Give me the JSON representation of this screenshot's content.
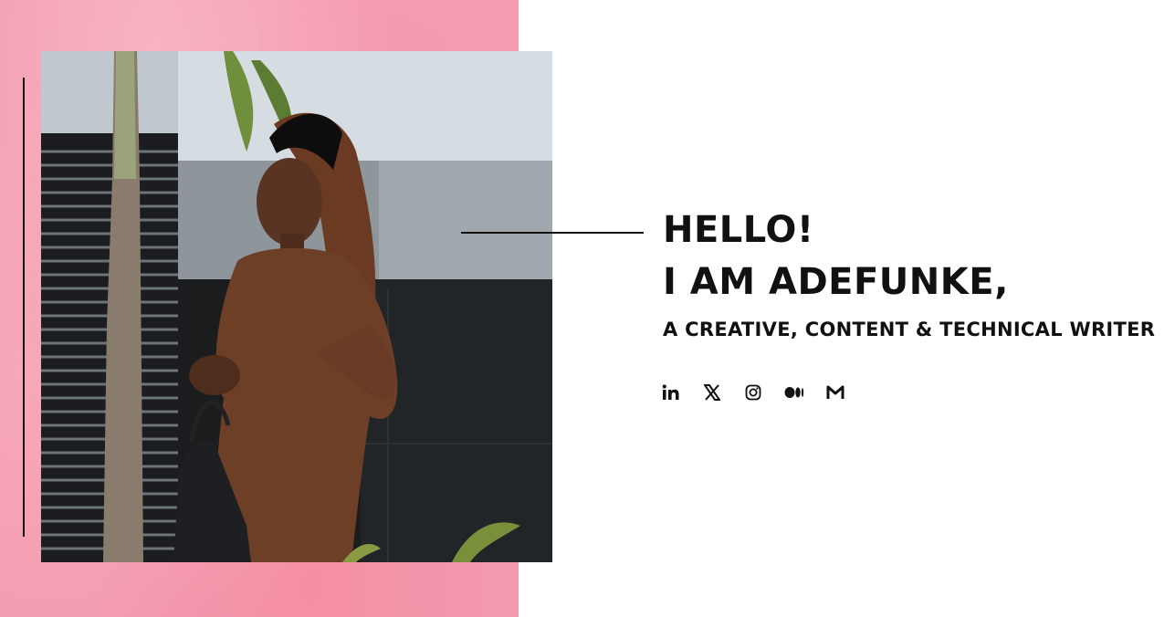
{
  "hero": {
    "greeting": "HELLO!",
    "name": "I AM ADEFUNKE,",
    "tagline": "A CREATIVE, CONTENT & TECHNICAL WRITER"
  },
  "photo": {
    "subject": "portrait-photo"
  },
  "socials": [
    {
      "name": "linkedin",
      "icon": "linkedin-icon"
    },
    {
      "name": "x",
      "icon": "x-icon"
    },
    {
      "name": "instagram",
      "icon": "instagram-icon"
    },
    {
      "name": "medium",
      "icon": "medium-icon"
    },
    {
      "name": "gmail",
      "icon": "mail-icon"
    }
  ],
  "colors": {
    "accent_pink": "#f39cb0",
    "text": "#111111",
    "background": "#ffffff"
  }
}
